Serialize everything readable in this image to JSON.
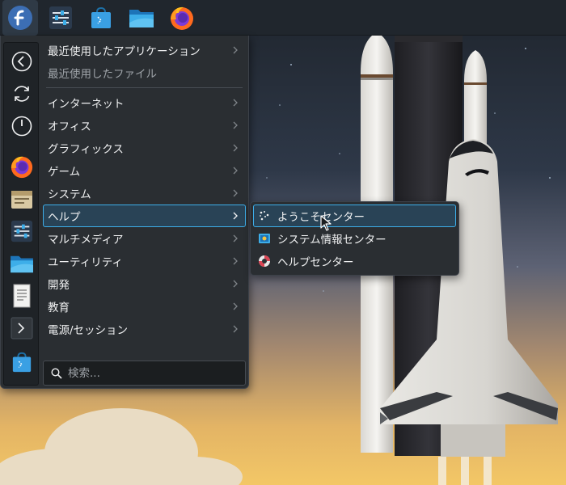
{
  "panel": {
    "items": [
      {
        "icon": "fedora-logo-icon",
        "active": true
      },
      {
        "icon": "settings-sliders-icon"
      },
      {
        "icon": "software-store-icon"
      },
      {
        "icon": "file-manager-folder-icon"
      },
      {
        "icon": "firefox-icon"
      }
    ]
  },
  "launcher": {
    "favorites": [
      {
        "icon": "back-circle-icon"
      },
      {
        "icon": "refresh-icon"
      },
      {
        "icon": "power-icon"
      },
      {
        "icon": "firefox-icon"
      },
      {
        "icon": "archive-icon"
      },
      {
        "icon": "settings-sliders-icon"
      },
      {
        "icon": "file-manager-folder-icon"
      },
      {
        "icon": "text-document-icon"
      },
      {
        "icon": "terminal-icon"
      },
      {
        "icon": "software-store-icon"
      }
    ],
    "recent": [
      {
        "label": "最近使用したアプリケーション",
        "has_arrow": true
      },
      {
        "label": "最近使用したファイル",
        "has_arrow": false,
        "disabled": true
      }
    ],
    "categories": [
      {
        "label": "インターネット"
      },
      {
        "label": "オフィス"
      },
      {
        "label": "グラフィックス"
      },
      {
        "label": "ゲーム"
      },
      {
        "label": "システム"
      },
      {
        "label": "ヘルプ",
        "selected": true
      },
      {
        "label": "マルチメディア"
      },
      {
        "label": "ユーティリティ"
      },
      {
        "label": "開発"
      },
      {
        "label": "教育"
      },
      {
        "label": "電源/セッション"
      }
    ],
    "search": {
      "placeholder": "検索...",
      "value": ""
    }
  },
  "submenu": {
    "items": [
      {
        "label": "ようこそセンター",
        "icon": "welcome-dots-icon",
        "selected": true
      },
      {
        "label": "システム情報センター",
        "icon": "system-info-icon"
      },
      {
        "label": "ヘルプセンター",
        "icon": "lifebuoy-icon"
      }
    ]
  },
  "colors": {
    "panel_bg": "#20262d",
    "menu_bg": "#2a2e32",
    "highlight_bg": "#294356",
    "accent": "#3daee9",
    "text": "#eff0f1",
    "dim_text": "#9ea3a8"
  }
}
